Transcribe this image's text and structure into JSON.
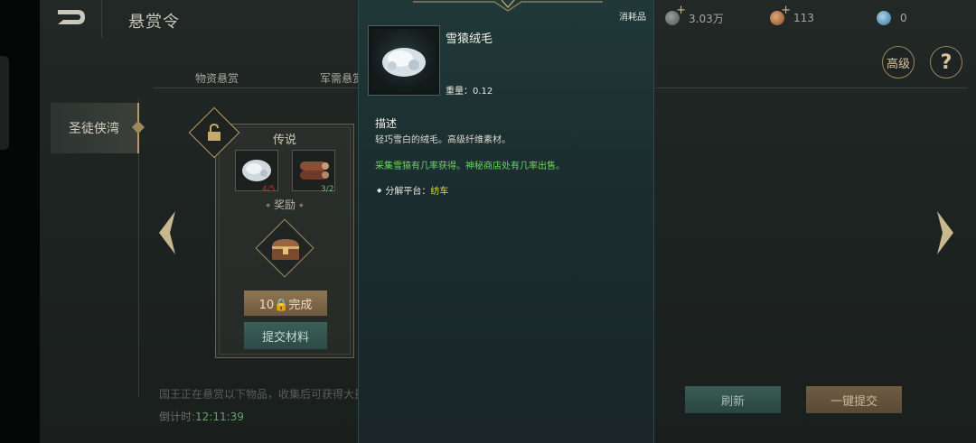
{
  "header": {
    "title": "悬赏令",
    "currencies": [
      {
        "icon": "silver-coin-icon",
        "value": "3.03万"
      },
      {
        "icon": "copper-coin-icon",
        "value": "113"
      },
      {
        "icon": "blue-gem-icon",
        "value": "0"
      }
    ],
    "advanced_label": "高级",
    "help_label": "?"
  },
  "tabs": [
    {
      "label": "物资悬赏"
    },
    {
      "label": "军需悬赏"
    }
  ],
  "region": {
    "label": "圣徒侠湾"
  },
  "bounty_card": {
    "rarity": "传说",
    "materials": [
      {
        "icon": "snow-ape-fur-icon",
        "progress": "4/5"
      },
      {
        "icon": "log-bundle-icon",
        "progress": "3/2"
      }
    ],
    "reward_label": "奖励",
    "complete_button": "10🔒完成",
    "submit_button": "提交材料"
  },
  "footer": {
    "info_text": "国王正在悬赏以下物品，收集后可获得大量奖励",
    "countdown_label": "倒计时:",
    "countdown_value": "12:11:39",
    "refresh_button": "刷新",
    "one_click_submit_button": "一键提交"
  },
  "tooltip": {
    "type": "消耗品",
    "item_name": "雪猿绒毛",
    "weight": "重量：0.12",
    "desc_title": "描述",
    "desc": "轻巧雪白的绒毛。高级纤维素材。",
    "source": "采集雪猿有几率获得。神秘商店处有几率出售。",
    "decompose_label": "分解平台：",
    "decompose_value": "纺车"
  },
  "colors": {
    "accent_gold": "#b59b6b",
    "source_green": "#67d85a",
    "decompose_yellow": "#e3d84a",
    "submit_teal": "#3a5f58"
  }
}
